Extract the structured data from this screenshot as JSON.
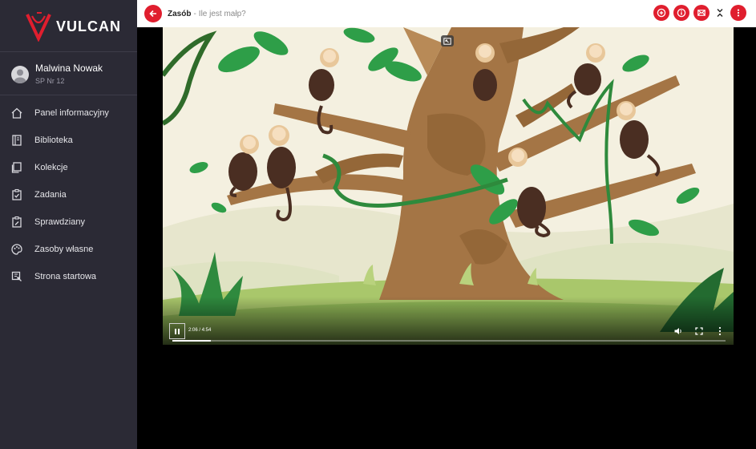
{
  "brand": {
    "name": "VULCAN",
    "accent": "#e01e2e",
    "sidebar_bg": "#2b2a35"
  },
  "user": {
    "name": "Malwina Nowak",
    "school": "SP Nr 12"
  },
  "sidebar": {
    "items": [
      {
        "label": "Panel informacyjny",
        "icon": "home-icon"
      },
      {
        "label": "Biblioteka",
        "icon": "book-icon"
      },
      {
        "label": "Kolekcje",
        "icon": "collections-icon"
      },
      {
        "label": "Zadania",
        "icon": "tasks-icon"
      },
      {
        "label": "Sprawdziany",
        "icon": "tests-icon"
      },
      {
        "label": "Zasoby własne",
        "icon": "palette-icon"
      },
      {
        "label": "Strona startowa",
        "icon": "start-page-icon"
      }
    ]
  },
  "topbar": {
    "title": "Zasób",
    "separator": "-",
    "subtitle": "Ile jest małp?",
    "actions": [
      "plus-circle-icon",
      "info-circle-icon",
      "mail-icon",
      "collapse-chevrons-icon",
      "more-vertical-icon"
    ]
  },
  "player": {
    "time": "2:06 / 4:54",
    "progress": 0.07,
    "icons": [
      "pause-icon",
      "volume-icon",
      "fullscreen-icon",
      "more-vertical-icon",
      "picture-in-picture-icon"
    ]
  }
}
